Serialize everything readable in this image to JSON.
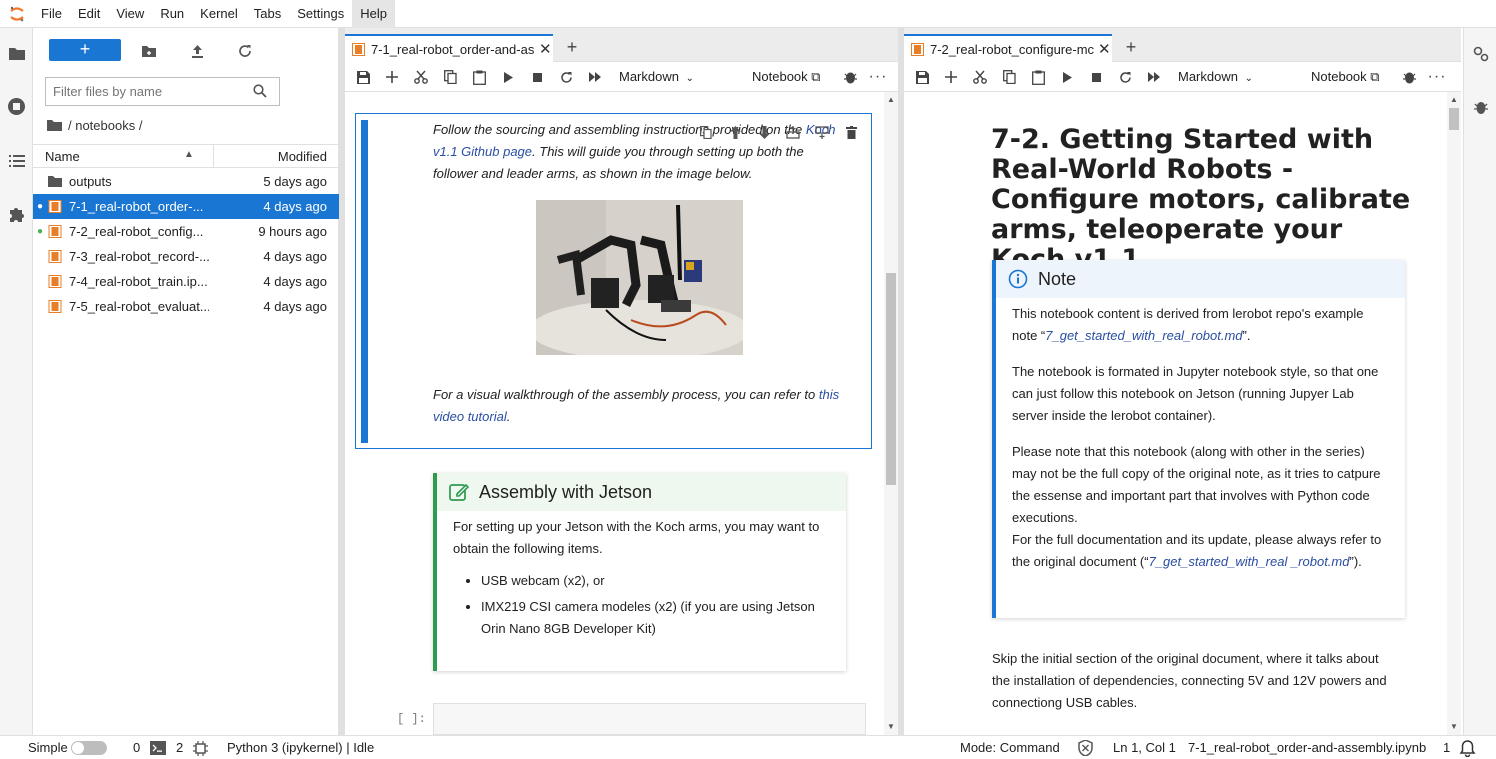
{
  "menu": [
    "File",
    "Edit",
    "View",
    "Run",
    "Kernel",
    "Tabs",
    "Settings",
    "Help"
  ],
  "menu_active": "Help",
  "filebrowser": {
    "new_label": "+",
    "filter_placeholder": "Filter files by name",
    "breadcrumb": "/ notebooks /",
    "col_name": "Name",
    "col_modified": "Modified",
    "files": [
      {
        "name": "outputs",
        "modified": "5 days ago",
        "type": "folder",
        "selected": false,
        "running": false
      },
      {
        "name": "7-1_real-robot_order-...",
        "modified": "4 days ago",
        "type": "notebook",
        "selected": true,
        "running": true
      },
      {
        "name": "7-2_real-robot_config...",
        "modified": "9 hours ago",
        "type": "notebook",
        "selected": false,
        "running": true
      },
      {
        "name": "7-3_real-robot_record-...",
        "modified": "4 days ago",
        "type": "notebook",
        "selected": false,
        "running": false
      },
      {
        "name": "7-4_real-robot_train.ip...",
        "modified": "4 days ago",
        "type": "notebook",
        "selected": false,
        "running": false
      },
      {
        "name": "7-5_real-robot_evaluat...",
        "modified": "4 days ago",
        "type": "notebook",
        "selected": false,
        "running": false
      }
    ]
  },
  "left_panel": {
    "tab_title": "7-1_real-robot_order-and-as",
    "cell_type": "Markdown",
    "kernel_label": "Notebook",
    "p1_a": "Follow the sourcing and assembling instructions provided on the",
    "p1_link": "Koch v1.1 Github page",
    "p1_b": ". This will guide you through setting up both the follower and leader arms, as shown in the image below.",
    "p2_a": "For a visual walkthrough of the assembly process, you can refer to",
    "p2_link": "this video tutorial",
    "p2_b": ".",
    "callout_title": "Assembly with Jetson",
    "callout_text": "For setting up your Jetson with the Koch arms, you may want to obtain the following items.",
    "bullets": [
      "USB webcam (x2), or",
      "IMX219 CSI camera modeles (x2) (if you are using Jetson Orin Nano 8GB Developer Kit)"
    ],
    "prompt": "[ ]:"
  },
  "right_panel": {
    "tab_title": "7-2_real-robot_configure-mc",
    "cell_type": "Markdown",
    "kernel_label": "Notebook",
    "heading": "7-2. Getting Started with Real-World Robots - Configure motors, calibrate arms, teleoperate your Koch v1.1",
    "note_title": "Note",
    "note_p1_a": "This notebook content is derived from lerobot repo's example note “",
    "note_p1_link": "7_get_started_with_real_robot.md",
    "note_p1_b": "”.",
    "note_p2": "The notebook is formated in Jupyter notebook style, so that one can just follow this notebook on Jetson (running Jupyer Lab server inside the lerobot container).",
    "note_p3": "Please note that this notebook (along with other in the series) may not be the full copy of the original note, as it tries to catpure the essense and important part that involves with Python code executions.",
    "note_p4_a": "For the full documentation and its update, please always refer to the original document (“",
    "note_p4_link": "7_get_started_with_real _robot.md",
    "note_p4_b": "”).",
    "para": "Skip the initial section of the original document, where it talks about the installation of dependencies, connecting 5V and 12V powers and connectiong USB cables."
  },
  "status": {
    "mode_label": "Simple",
    "terminals": "0",
    "kernels": "2",
    "kernel": "Python 3 (ipykernel) | Idle",
    "command_mode": "Mode: Command",
    "position": "Ln 1, Col 1",
    "filename": "7-1_real-robot_order-and-assembly.ipynb",
    "notifications": "1"
  },
  "colors": {
    "accent": "#1976d2",
    "note": "#1976d2",
    "success": "#2e9b4f",
    "notebook_icon": "#e87e27"
  }
}
